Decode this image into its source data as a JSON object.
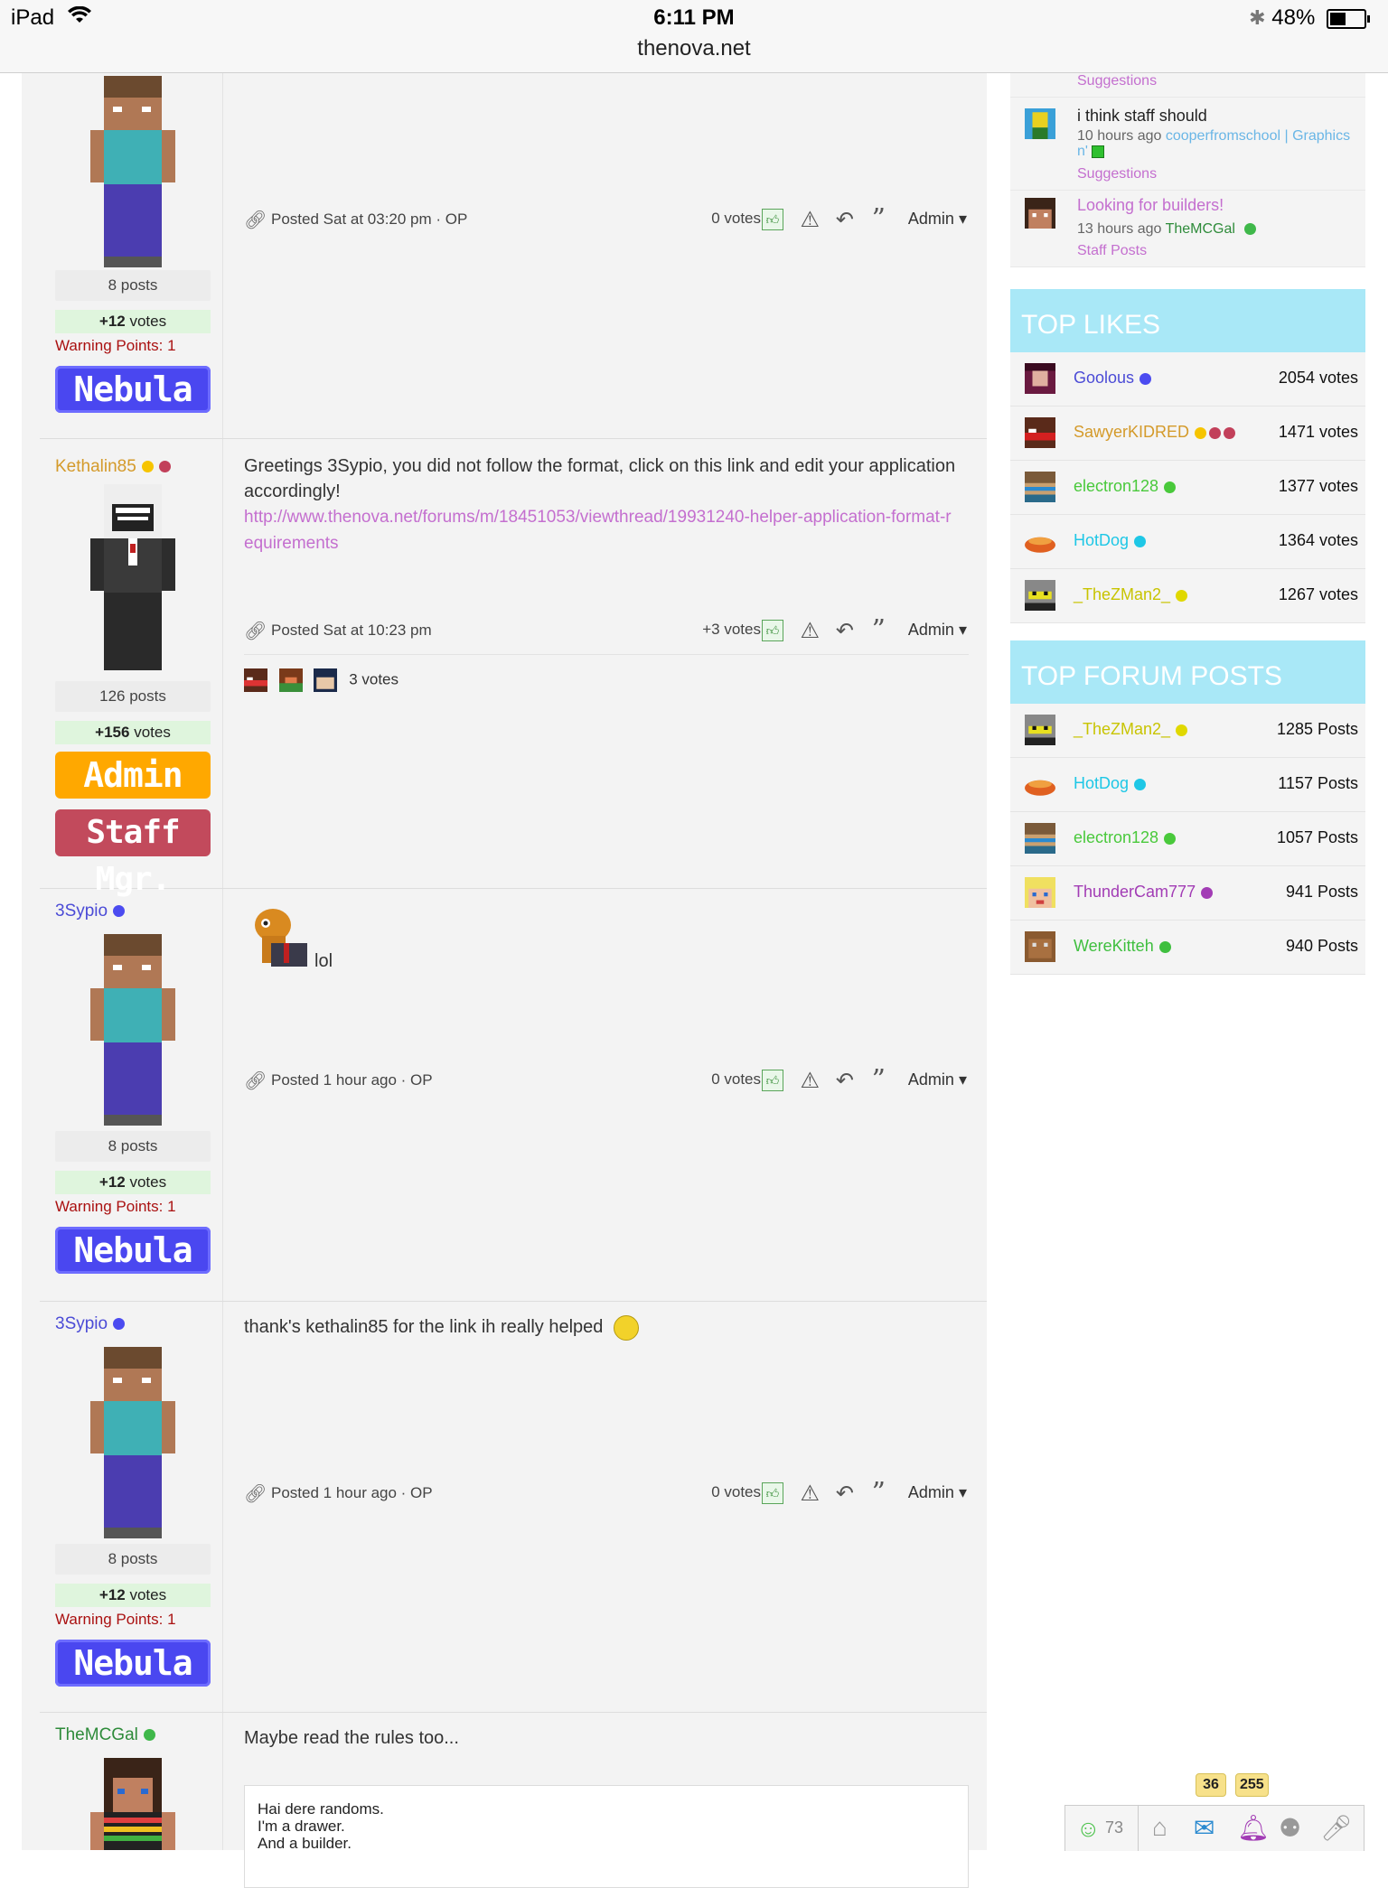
{
  "statusbar": {
    "device": "iPad",
    "time": "6:11 PM",
    "url": "thenova.net",
    "battery": "48%",
    "battery_level": 0.48
  },
  "posts": [
    {
      "username": "",
      "posts": "8 posts",
      "votes_num": "+12",
      "votes_word": " votes",
      "warning": "Warning Points: 1",
      "rank": "Nebula",
      "posted": "Posted Sat at 03:20 pm · OP",
      "vote_count": "0  votes",
      "admin": "Admin"
    },
    {
      "username": "Kethalin85",
      "text": "Greetings 3Sypio, you did not follow the format, click on this link and edit your application accordingly!",
      "link": "http://www.thenova.net/forums/m/18451053/viewthread/19931240-helper-application-format-requirements",
      "posts": "126 posts",
      "votes_num": "+156",
      "votes_word": " votes",
      "rank1": "Admin",
      "rank2": "Staff Mgr.",
      "posted": "Posted Sat at 10:23 pm",
      "vote_count": "+3  votes",
      "voters": "3 votes",
      "admin": "Admin"
    },
    {
      "username": "3Sypio",
      "text": "lol",
      "posts": "8 posts",
      "votes_num": "+12",
      "votes_word": " votes",
      "warning": "Warning Points: 1",
      "rank": "Nebula",
      "posted": "Posted 1 hour ago · OP",
      "vote_count": "0  votes",
      "admin": "Admin"
    },
    {
      "username": "3Sypio",
      "text": "thank's kethalin85 for the link ih really helped",
      "posts": "8 posts",
      "votes_num": "+12",
      "votes_word": " votes",
      "warning": "Warning Points: 1",
      "rank": "Nebula",
      "posted": "Posted 1 hour ago · OP",
      "vote_count": "0  votes",
      "admin": "Admin"
    },
    {
      "username": "TheMCGal",
      "text": "Maybe read the rules too...",
      "quote_line1": "Hai dere randoms.",
      "quote_line2": "I'm a drawer.",
      "quote_line3": "And a builder."
    }
  ],
  "sidebar": {
    "activity": [
      {
        "category": "Suggestions"
      },
      {
        "title": "i think staff should",
        "time": "10 hours ago",
        "user": "cooperfromschool | Graphics n'",
        "category": "Suggestions"
      },
      {
        "title": "Looking for builders!",
        "time": "13 hours ago",
        "user": "TheMCGal",
        "category": "Staff Posts"
      }
    ],
    "top_likes_title": "TOP LIKES",
    "top_likes": [
      {
        "name": "Goolous",
        "value": "2054 votes",
        "color": "#4b4bd6"
      },
      {
        "name": "SawyerKIDRED",
        "value": "1471 votes",
        "color": "#d49a2a"
      },
      {
        "name": "electron128",
        "value": "1377 votes",
        "color": "#49c93b"
      },
      {
        "name": "HotDog",
        "value": "1364 votes",
        "color": "#1ec7e6"
      },
      {
        "name": "_TheZMan2_",
        "value": "1267 votes",
        "color": "#c8c400"
      }
    ],
    "top_posts_title": "TOP FORUM POSTS",
    "top_posts": [
      {
        "name": "_TheZMan2_",
        "value": "1285 Posts",
        "color": "#c8c400"
      },
      {
        "name": "HotDog",
        "value": "1157 Posts",
        "color": "#1ec7e6"
      },
      {
        "name": "electron128",
        "value": "1057 Posts",
        "color": "#49c93b"
      },
      {
        "name": "ThunderCam777",
        "value": "941 Posts",
        "color": "#a23cb5"
      },
      {
        "name": "WereKitteh",
        "value": "940 Posts",
        "color": "#3fbf3f"
      }
    ]
  },
  "toolbar": {
    "online": "73",
    "badge_mail": "36",
    "badge_notif": "255"
  },
  "icons": [
    "wifi-icon",
    "bluetooth-icon",
    "battery-icon",
    "link-icon",
    "thumbs-up-icon",
    "warning-icon",
    "reply-icon",
    "quote-icon",
    "chevron-down-icon",
    "user-icon",
    "home-icon",
    "mail-icon",
    "bell-icon",
    "group-icon",
    "mic-icon"
  ],
  "colors": {
    "nebula": "#4a47f0",
    "admin": "#ffa800",
    "staff_mgr": "#c24a5c",
    "link": "#c46fcf",
    "panel_header": "#a9e8f7",
    "username_blue": "#4b4bd6",
    "username_orange": "#d49a2a",
    "username_green": "#2e8b3a"
  }
}
